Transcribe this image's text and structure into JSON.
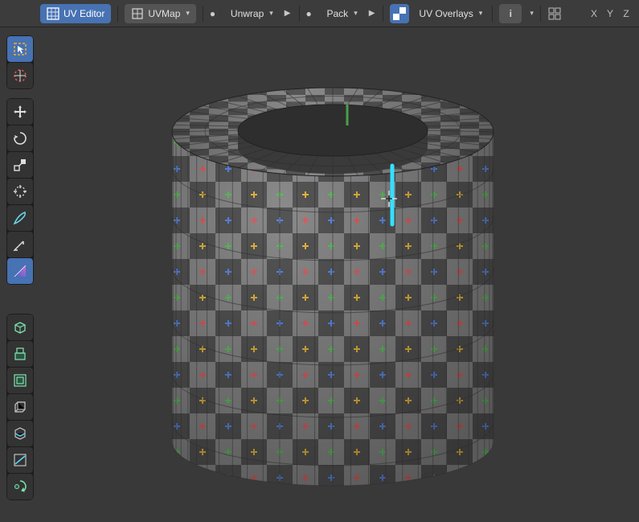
{
  "header": {
    "editor_label": "UV Editor",
    "uvmap_label": "UVMap",
    "unwrap_label": "Unwrap",
    "pack_label": "Pack",
    "overlays_label": "UV Overlays",
    "axes": {
      "x": "X",
      "y": "Y",
      "z": "Z"
    }
  },
  "icons": {
    "editor": "uv-editor-icon",
    "map": "uv-map-icon",
    "circle": "dot-icon",
    "overlay": "checker-icon",
    "info": "info-icon",
    "collapsed": "options-icon"
  },
  "tool_groups": {
    "a": [
      "cursor-tool",
      "3d-cursor-tool"
    ],
    "b": [
      "move-tool",
      "rotate-tool",
      "scale-tool",
      "transform-tool",
      "annotate-tool",
      "measure-tool",
      "gradient-tool"
    ],
    "c": [
      "add-cube-tool",
      "extrude-region-tool",
      "inset-faces-tool",
      "bevel-tool",
      "loop-cut-tool",
      "knife-tool",
      "spin-tool"
    ]
  },
  "active_tools": {
    "a": 0,
    "b": 6
  },
  "colors": {
    "accent": "#4772b3",
    "seam": "#35e0ff",
    "check_dark": "#4e4e4e",
    "check_light": "#8a8a8a"
  }
}
